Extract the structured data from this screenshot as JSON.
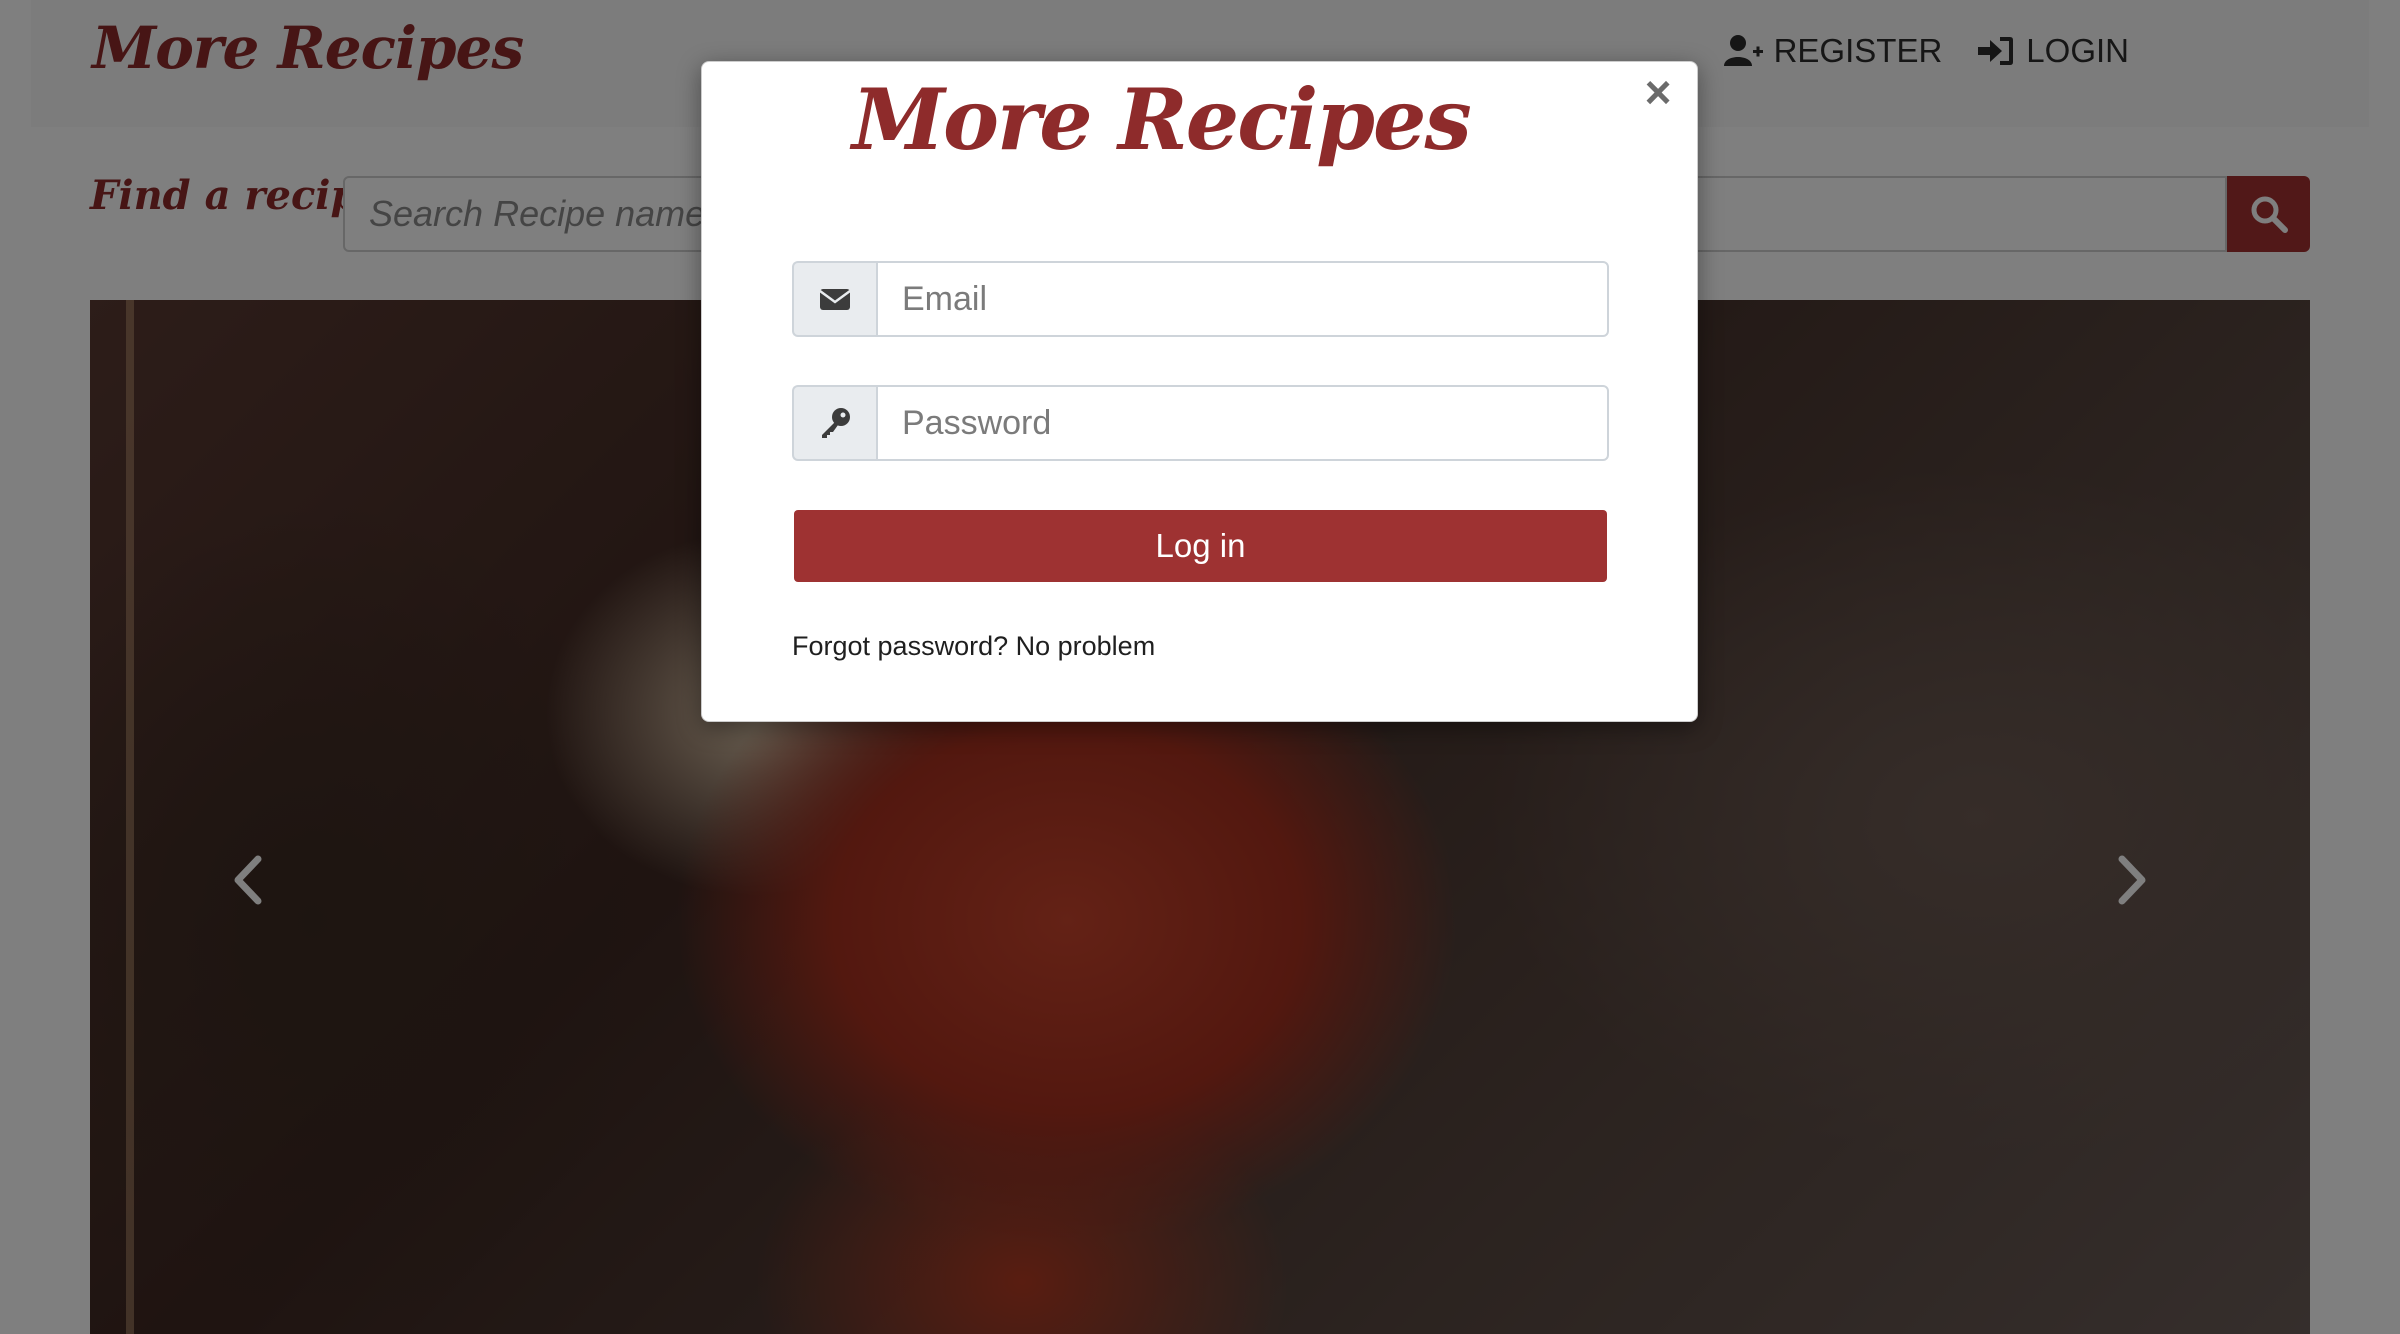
{
  "navbar": {
    "brand": "More Recipes",
    "links": [
      {
        "label": "REGISTER",
        "icon": "user-plus-icon"
      },
      {
        "label": "LOGIN",
        "icon": "sign-in-icon"
      }
    ]
  },
  "search": {
    "label": "Find a recipe:",
    "placeholder": "Search Recipe name or",
    "button_icon": "search-icon"
  },
  "carousel": {
    "prev_icon": "chevron-left-icon",
    "next_icon": "chevron-right-icon"
  },
  "login_modal": {
    "brand": "More Recipes",
    "close_label": "×",
    "email_placeholder": "Email",
    "email_icon": "envelope-icon",
    "password_placeholder": "Password",
    "password_icon": "key-icon",
    "submit_label": "Log in",
    "forgot_text": "Forgot password?",
    "forgot_link": "No problem"
  },
  "colors": {
    "brand": "#8e2b2b",
    "button": "#9e3232",
    "search_button": "#a33131",
    "overlay": "rgba(0,0,0,0.5)"
  }
}
